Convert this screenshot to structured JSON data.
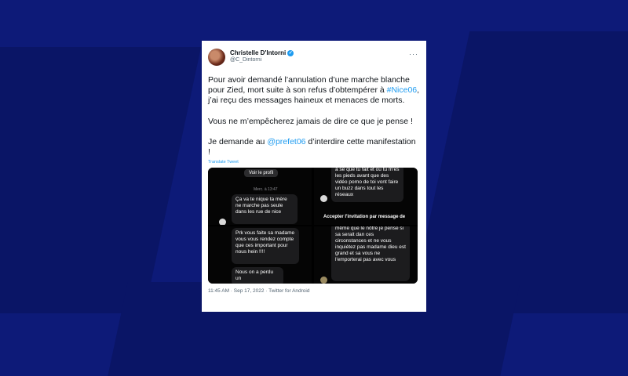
{
  "tweet": {
    "author_name": "Christelle D'Intorni",
    "handle": "@C_Dintorni",
    "paragraph1_a": "Pour avoir demandé l’annulation d’une marche blanche pour Zied, mort suite à son refus d’obtempérer à ",
    "hashtag": "#Nice06",
    "paragraph1_b": ", j’ai reçu des messages haineux et menaces de morts.",
    "paragraph2": "Vous ne m’empêcherez jamais de dire ce que je pense !",
    "paragraph3_a": "Je demande au ",
    "mention": "@prefet06",
    "paragraph3_b": " d’interdire cette manifestation !",
    "translate": "Translate Tweet",
    "timestamp": "11:45 AM · Sep 17, 2022 · Twitter for Android"
  },
  "media": {
    "panel1": {
      "button": "Voir le profil",
      "date": "Merc. à 13:47",
      "message": "Ça va te nique ta mère ne marche pas seule dans les rue de nice"
    },
    "panel2": {
      "message": "à se que tu fait et ou tu m'es les pieds avant que des vidéo porno de toi vont faire un buzz dans tout les réseaux",
      "accept": "Accepter l'invitation par message de"
    },
    "panel3": {
      "message1": "Prk vous faite sa madame vous vous rendez compte que ces important pour nous hein !!!!",
      "message2": "Nous on a perdu un"
    },
    "panel4": {
      "message": "même que le nôtre je pense si sa serait dan ces circonstances et ne vous inquiétez pas madame dieu est grand et sa vous ne l'emporterai pas avec vous"
    }
  }
}
